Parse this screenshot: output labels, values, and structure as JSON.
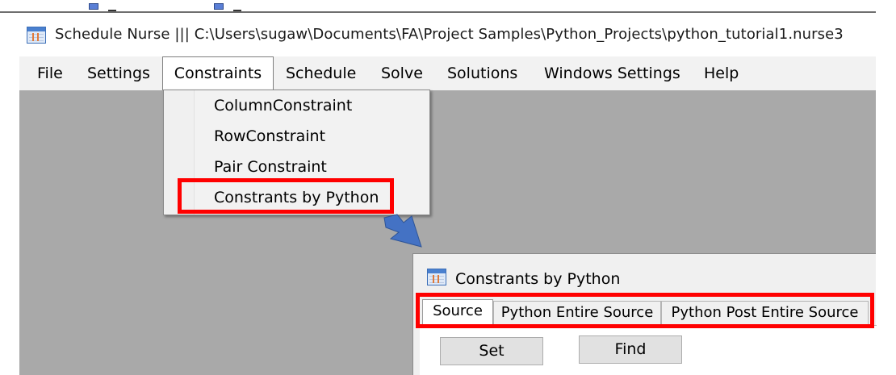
{
  "main_window": {
    "title": "Schedule Nurse |||   C:\\Users\\sugaw\\Documents\\FA\\Project Samples\\Python_Projects\\python_tutorial1.nurse3",
    "icon": "calendar-app-icon"
  },
  "menu": {
    "items": [
      {
        "label": "File"
      },
      {
        "label": "Settings"
      },
      {
        "label": "Constraints",
        "active": true
      },
      {
        "label": "Schedule"
      },
      {
        "label": "Solve"
      },
      {
        "label": "Solutions"
      },
      {
        "label": "Windows Settings"
      },
      {
        "label": "Help"
      }
    ]
  },
  "constraints_menu": {
    "items": [
      {
        "label": "ColumnConstraint"
      },
      {
        "label": "RowConstraint"
      },
      {
        "label": "Pair Constraint"
      },
      {
        "label": "Constrants by Python",
        "highlighted": true
      }
    ]
  },
  "child_window": {
    "title": "Constrants by Python",
    "icon": "calendar-app-icon",
    "tabs": [
      {
        "label": "Source",
        "selected": true
      },
      {
        "label": "Python Entire Source"
      },
      {
        "label": "Python Post Entire Source"
      }
    ],
    "buttons": {
      "set_label": "Set",
      "find_label": "Find"
    }
  },
  "colors": {
    "highlight_box": "#ff0000",
    "arrow": "#4472c4",
    "workspace": "#a9a9a9",
    "menubar": "#f2f2f2"
  }
}
